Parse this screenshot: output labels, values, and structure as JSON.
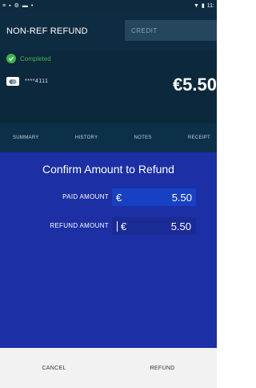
{
  "status_bar": {
    "right_text": "11:"
  },
  "header": {
    "title": "NON-REF REFUND",
    "credit_placeholder": "CREDIT"
  },
  "transaction": {
    "status": "Completed",
    "card_masked": "****4111",
    "amount": "€5.50"
  },
  "tabs": [
    {
      "label": "SUMMARY"
    },
    {
      "label": "HISTORY"
    },
    {
      "label": "NOTES"
    },
    {
      "label": "RECEIPT"
    }
  ],
  "refund_dialog": {
    "title": "Confirm Amount to Refund",
    "paid_label": "PAID AMOUNT",
    "paid_currency": "€",
    "paid_value": "5.50",
    "refund_label": "REFUND AMOUNT",
    "refund_currency": "€",
    "refund_value": "5.50"
  },
  "footer": {
    "cancel_label": "CANCEL",
    "refund_label": "REFUND"
  },
  "colors": {
    "header": "#0e2c41",
    "panel": "#1c2fa4",
    "success": "#3bb54a",
    "field": "#1741c2"
  }
}
